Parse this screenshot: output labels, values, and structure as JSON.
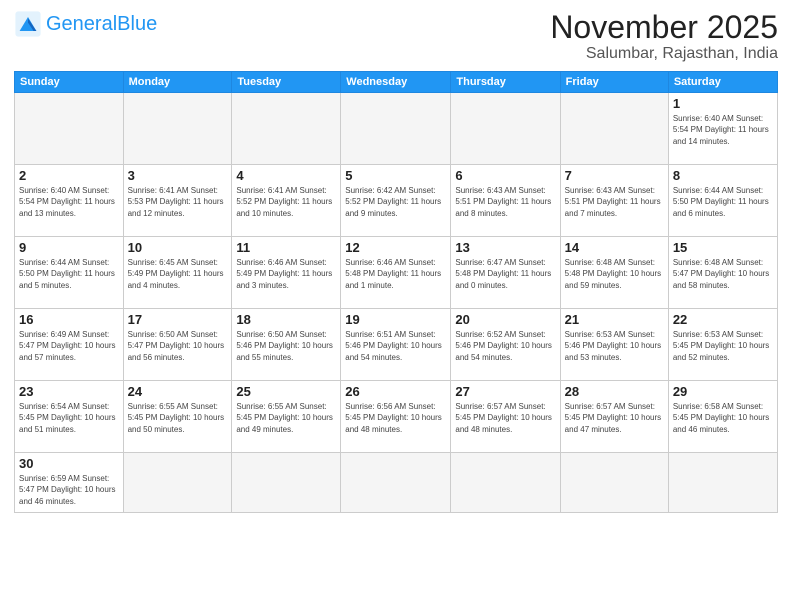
{
  "header": {
    "logo_general": "General",
    "logo_blue": "Blue",
    "month": "November 2025",
    "location": "Salumbar, Rajasthan, India"
  },
  "days_of_week": [
    "Sunday",
    "Monday",
    "Tuesday",
    "Wednesday",
    "Thursday",
    "Friday",
    "Saturday"
  ],
  "weeks": [
    [
      {
        "day": "",
        "info": ""
      },
      {
        "day": "",
        "info": ""
      },
      {
        "day": "",
        "info": ""
      },
      {
        "day": "",
        "info": ""
      },
      {
        "day": "",
        "info": ""
      },
      {
        "day": "",
        "info": ""
      },
      {
        "day": "1",
        "info": "Sunrise: 6:40 AM\nSunset: 5:54 PM\nDaylight: 11 hours\nand 14 minutes."
      }
    ],
    [
      {
        "day": "2",
        "info": "Sunrise: 6:40 AM\nSunset: 5:54 PM\nDaylight: 11 hours\nand 13 minutes."
      },
      {
        "day": "3",
        "info": "Sunrise: 6:41 AM\nSunset: 5:53 PM\nDaylight: 11 hours\nand 12 minutes."
      },
      {
        "day": "4",
        "info": "Sunrise: 6:41 AM\nSunset: 5:52 PM\nDaylight: 11 hours\nand 10 minutes."
      },
      {
        "day": "5",
        "info": "Sunrise: 6:42 AM\nSunset: 5:52 PM\nDaylight: 11 hours\nand 9 minutes."
      },
      {
        "day": "6",
        "info": "Sunrise: 6:43 AM\nSunset: 5:51 PM\nDaylight: 11 hours\nand 8 minutes."
      },
      {
        "day": "7",
        "info": "Sunrise: 6:43 AM\nSunset: 5:51 PM\nDaylight: 11 hours\nand 7 minutes."
      },
      {
        "day": "8",
        "info": "Sunrise: 6:44 AM\nSunset: 5:50 PM\nDaylight: 11 hours\nand 6 minutes."
      }
    ],
    [
      {
        "day": "9",
        "info": "Sunrise: 6:44 AM\nSunset: 5:50 PM\nDaylight: 11 hours\nand 5 minutes."
      },
      {
        "day": "10",
        "info": "Sunrise: 6:45 AM\nSunset: 5:49 PM\nDaylight: 11 hours\nand 4 minutes."
      },
      {
        "day": "11",
        "info": "Sunrise: 6:46 AM\nSunset: 5:49 PM\nDaylight: 11 hours\nand 3 minutes."
      },
      {
        "day": "12",
        "info": "Sunrise: 6:46 AM\nSunset: 5:48 PM\nDaylight: 11 hours\nand 1 minute."
      },
      {
        "day": "13",
        "info": "Sunrise: 6:47 AM\nSunset: 5:48 PM\nDaylight: 11 hours\nand 0 minutes."
      },
      {
        "day": "14",
        "info": "Sunrise: 6:48 AM\nSunset: 5:48 PM\nDaylight: 10 hours\nand 59 minutes."
      },
      {
        "day": "15",
        "info": "Sunrise: 6:48 AM\nSunset: 5:47 PM\nDaylight: 10 hours\nand 58 minutes."
      }
    ],
    [
      {
        "day": "16",
        "info": "Sunrise: 6:49 AM\nSunset: 5:47 PM\nDaylight: 10 hours\nand 57 minutes."
      },
      {
        "day": "17",
        "info": "Sunrise: 6:50 AM\nSunset: 5:47 PM\nDaylight: 10 hours\nand 56 minutes."
      },
      {
        "day": "18",
        "info": "Sunrise: 6:50 AM\nSunset: 5:46 PM\nDaylight: 10 hours\nand 55 minutes."
      },
      {
        "day": "19",
        "info": "Sunrise: 6:51 AM\nSunset: 5:46 PM\nDaylight: 10 hours\nand 54 minutes."
      },
      {
        "day": "20",
        "info": "Sunrise: 6:52 AM\nSunset: 5:46 PM\nDaylight: 10 hours\nand 54 minutes."
      },
      {
        "day": "21",
        "info": "Sunrise: 6:53 AM\nSunset: 5:46 PM\nDaylight: 10 hours\nand 53 minutes."
      },
      {
        "day": "22",
        "info": "Sunrise: 6:53 AM\nSunset: 5:45 PM\nDaylight: 10 hours\nand 52 minutes."
      }
    ],
    [
      {
        "day": "23",
        "info": "Sunrise: 6:54 AM\nSunset: 5:45 PM\nDaylight: 10 hours\nand 51 minutes."
      },
      {
        "day": "24",
        "info": "Sunrise: 6:55 AM\nSunset: 5:45 PM\nDaylight: 10 hours\nand 50 minutes."
      },
      {
        "day": "25",
        "info": "Sunrise: 6:55 AM\nSunset: 5:45 PM\nDaylight: 10 hours\nand 49 minutes."
      },
      {
        "day": "26",
        "info": "Sunrise: 6:56 AM\nSunset: 5:45 PM\nDaylight: 10 hours\nand 48 minutes."
      },
      {
        "day": "27",
        "info": "Sunrise: 6:57 AM\nSunset: 5:45 PM\nDaylight: 10 hours\nand 48 minutes."
      },
      {
        "day": "28",
        "info": "Sunrise: 6:57 AM\nSunset: 5:45 PM\nDaylight: 10 hours\nand 47 minutes."
      },
      {
        "day": "29",
        "info": "Sunrise: 6:58 AM\nSunset: 5:45 PM\nDaylight: 10 hours\nand 46 minutes."
      }
    ],
    [
      {
        "day": "30",
        "info": "Sunrise: 6:59 AM\nSunset: 5:47 PM\nDaylight: 10 hours\nand 46 minutes."
      },
      {
        "day": "",
        "info": ""
      },
      {
        "day": "",
        "info": ""
      },
      {
        "day": "",
        "info": ""
      },
      {
        "day": "",
        "info": ""
      },
      {
        "day": "",
        "info": ""
      },
      {
        "day": "",
        "info": ""
      }
    ]
  ]
}
